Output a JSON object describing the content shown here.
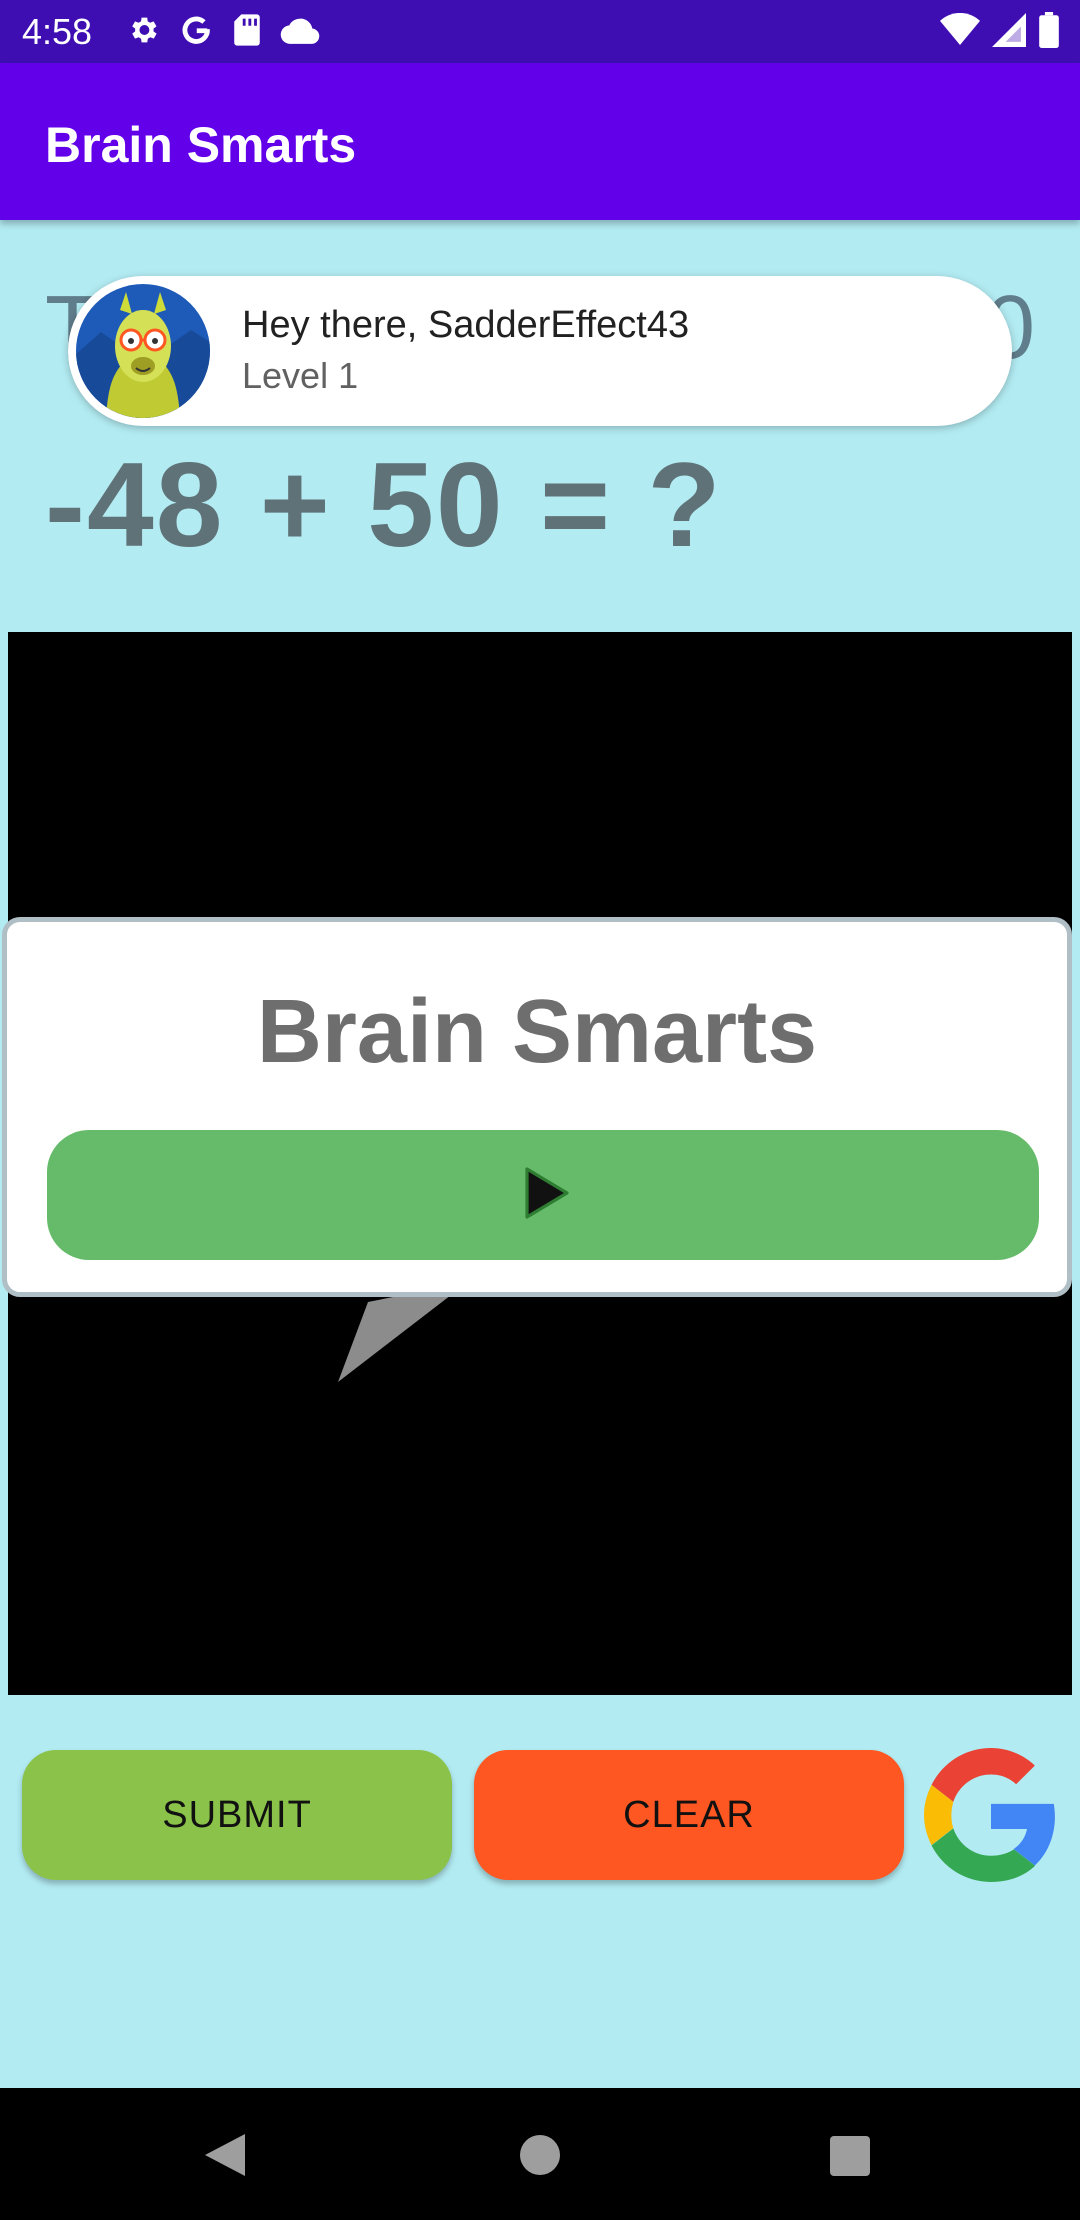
{
  "status_bar": {
    "time": "4:58",
    "left_icons": [
      "gear-icon",
      "google-g-icon",
      "sd-card-icon",
      "cloud-icon"
    ],
    "right_icons": [
      "wifi-icon",
      "signal-icon",
      "battery-icon"
    ]
  },
  "app_bar": {
    "title": "Brain Smarts",
    "color": "#6200ea"
  },
  "game": {
    "behind_text_left": "T",
    "behind_text_right": "0",
    "equation": "-48 + 50 = ?"
  },
  "toast": {
    "greeting": "Hey there, SadderEffect43",
    "level": "Level 1",
    "avatar_icon": "llama-avatar-icon"
  },
  "dialog": {
    "title": "Brain Smarts",
    "play_icon": "play-icon",
    "play_button_color": "#66bb6a"
  },
  "buttons": {
    "submit_label": "SUBMIT",
    "clear_label": "CLEAR",
    "submit_color": "#8bc34a",
    "clear_color": "#ff5722"
  },
  "nav_bar": {
    "icons": [
      "back-icon",
      "home-icon",
      "recents-icon"
    ]
  },
  "colors": {
    "background": "#b2ebf2",
    "status_bar": "#3e0eb2"
  }
}
